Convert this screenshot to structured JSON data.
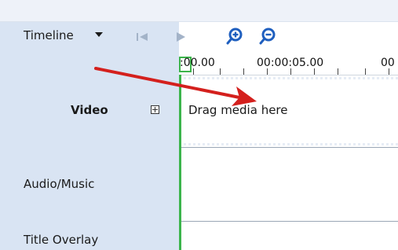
{
  "timeline": {
    "toolbar": {
      "label": "Timeline"
    },
    "ruler": {
      "ticks": [
        ":00.00",
        "00:00:05.00",
        "00"
      ]
    },
    "tracks": {
      "video": {
        "label": "Video",
        "placeholder": "Drag media here"
      },
      "audio": {
        "label": "Audio/Music"
      },
      "title": {
        "label": "Title Overlay"
      }
    }
  },
  "colors": {
    "panel_left": "#d9e4f3",
    "playhead": "#3cb44b",
    "arrow": "#d4201d",
    "zoom_icon": "#1f5fbf"
  }
}
